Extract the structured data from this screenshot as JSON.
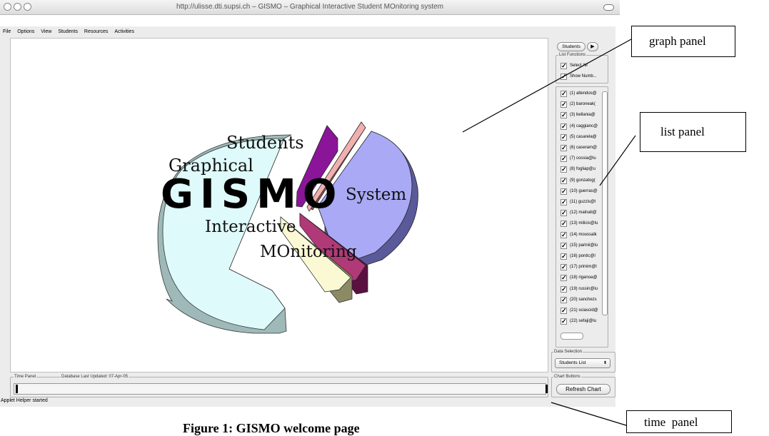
{
  "window": {
    "url_title": "http://ulisse.dti.supsi.ch – GISMO – Graphical Interactive Student MOnitoring system"
  },
  "menu": [
    "File",
    "Options",
    "View",
    "Students",
    "Resources",
    "Activities"
  ],
  "logo": {
    "word": "GISMO",
    "words": {
      "students": "Students",
      "graphical": "Graphical",
      "system": "System",
      "interactive": "Interactive",
      "monitoring": "MOnitoring"
    }
  },
  "right_panel": {
    "tab_label": "Students",
    "list_functions_legend": "List Functions",
    "select_all": "Select All",
    "show_numbers": "Show Numb...",
    "students": [
      "(1) altendos@",
      "(2) baroneak(",
      "(3) bellania@",
      "(4) caggianc@",
      "(5) casarela@",
      "(6) caseram@",
      "(7) cossia@lu",
      "(8) fogliap@u",
      "(9) gonzatog(",
      "(10) guerras@",
      "(11) guzzis@l",
      "(12) malnati@",
      "(13) milicis@lu",
      "(14) moussalk",
      "(15) parinii@lu",
      "(16) pontic@l",
      "(17) primim@l",
      "(18) riganoa@",
      "(19) russin@lu",
      "(20) sanchezs",
      "(21) sciascid@",
      "(22) sefaji@lu"
    ],
    "data_selection_legend": "Data Selection",
    "data_selection_value": "Students List",
    "chart_buttons_legend": "Chart Buttons",
    "refresh_label": "Refresh Chart"
  },
  "time_panel": {
    "legend": "Time Panel",
    "db_updated": "Database Last Updated: 07-Apr-05"
  },
  "status": "Applet Helper started",
  "annotations": {
    "graph_panel": "graph panel",
    "list_panel": "list panel",
    "time_panel": "time  panel"
  },
  "caption": "Figure 1: GISMO welcome page"
}
